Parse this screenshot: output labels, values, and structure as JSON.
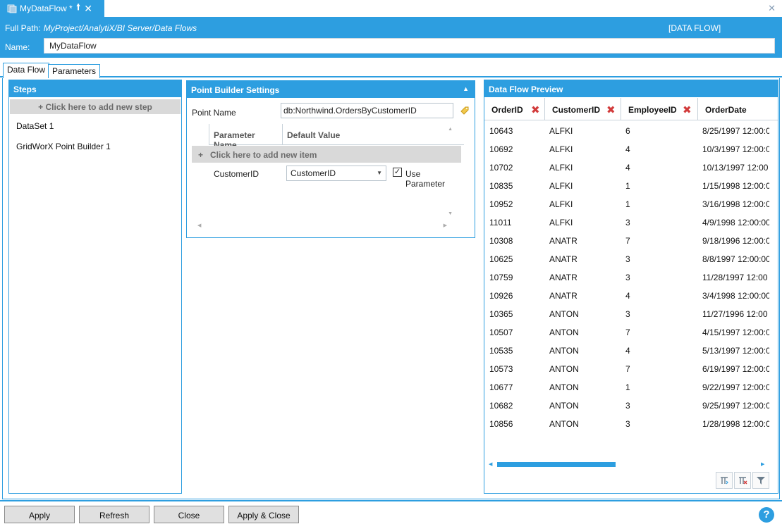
{
  "document_tab": {
    "title": "MyDataFlow *",
    "icon": "dataflow-icon",
    "pin_icon": "pin-icon",
    "close_icon": "close-icon"
  },
  "window": {
    "close_icon": "close-icon"
  },
  "header": {
    "full_path_label": "Full Path:",
    "full_path": "MyProject/AnalytiX/BI Server/Data Flows",
    "type": "[DATA FLOW]",
    "name_label": "Name:",
    "name_value": "MyDataFlow"
  },
  "tabs": [
    {
      "label": "Data Flow",
      "active": true
    },
    {
      "label": "Parameters",
      "active": false
    }
  ],
  "steps": {
    "title": "Steps",
    "add_label": "+  Click here to add new step",
    "items": [
      {
        "label": "DataSet  1"
      },
      {
        "label": "GridWorX Point Builder  1"
      }
    ]
  },
  "point_builder": {
    "title": "Point Builder Settings",
    "point_name_label": "Point Name",
    "point_name_value": "db:Northwind.OrdersByCustomerID",
    "columns": [
      "Parameter Name",
      "Default Value"
    ],
    "add_item_label": "Click here to add new item",
    "rows": [
      {
        "name": "CustomerID",
        "default": "CustomerID",
        "use_parameter": true,
        "use_parameter_label": "Use Parameter"
      }
    ]
  },
  "preview": {
    "title": "Data Flow Preview",
    "columns": [
      "OrderID",
      "CustomerID",
      "EmployeeID",
      "OrderDate"
    ],
    "rows": [
      [
        "10643",
        "ALFKI",
        "6",
        "8/25/1997 12:00:0"
      ],
      [
        "10692",
        "ALFKI",
        "4",
        "10/3/1997 12:00:0"
      ],
      [
        "10702",
        "ALFKI",
        "4",
        "10/13/1997 12:00"
      ],
      [
        "10835",
        "ALFKI",
        "1",
        "1/15/1998 12:00:0"
      ],
      [
        "10952",
        "ALFKI",
        "1",
        "3/16/1998 12:00:0"
      ],
      [
        "11011",
        "ALFKI",
        "3",
        "4/9/1998 12:00:00"
      ],
      [
        "10308",
        "ANATR",
        "7",
        "9/18/1996 12:00:0"
      ],
      [
        "10625",
        "ANATR",
        "3",
        "8/8/1997 12:00:00"
      ],
      [
        "10759",
        "ANATR",
        "3",
        "11/28/1997 12:00"
      ],
      [
        "10926",
        "ANATR",
        "4",
        "3/4/1998 12:00:00"
      ],
      [
        "10365",
        "ANTON",
        "3",
        "11/27/1996 12:00"
      ],
      [
        "10507",
        "ANTON",
        "7",
        "4/15/1997 12:00:0"
      ],
      [
        "10535",
        "ANTON",
        "4",
        "5/13/1997 12:00:0"
      ],
      [
        "10573",
        "ANTON",
        "7",
        "6/19/1997 12:00:0"
      ],
      [
        "10677",
        "ANTON",
        "1",
        "9/22/1997 12:00:0"
      ],
      [
        "10682",
        "ANTON",
        "3",
        "9/25/1997 12:00:0"
      ],
      [
        "10856",
        "ANTON",
        "3",
        "1/28/1998 12:00:0"
      ]
    ],
    "tools": [
      "column-chooser-icon",
      "clear-columns-icon",
      "filter-icon"
    ]
  },
  "footer": {
    "buttons": [
      "Apply",
      "Refresh",
      "Close",
      "Apply & Close"
    ],
    "help": "?"
  },
  "colors": {
    "accent": "#2d9ee0",
    "remove": "#d23b3b",
    "add_bar": "#d9d9d9"
  }
}
